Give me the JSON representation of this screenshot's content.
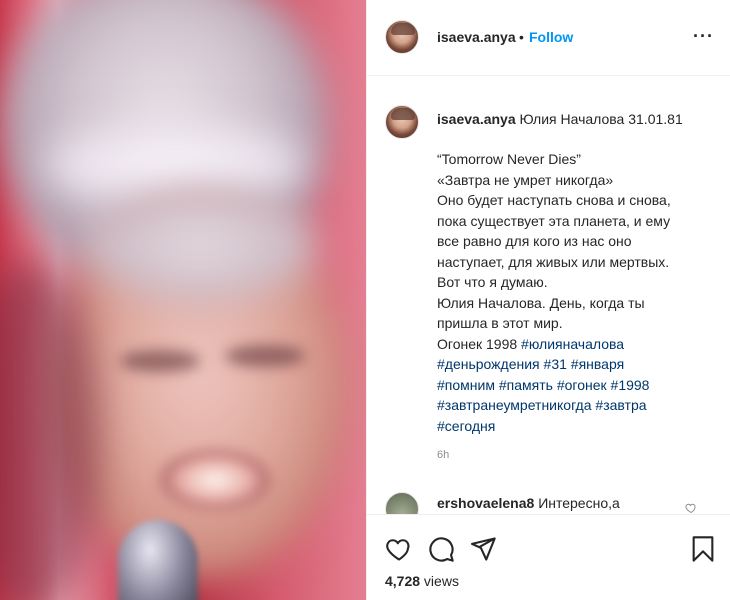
{
  "post": {
    "author": "isaeva.anya",
    "separator": "•",
    "follow_label": "Follow",
    "more_label": "···"
  },
  "caption": {
    "author": "isaeva.anya",
    "header_text": "Юлия Началова 31.01.81",
    "lines": [
      "“Tomorrow Never Dies”",
      "«Завтра не умрет никогда»",
      "Оно будет наступать снова и снова,",
      "пока существует эта планета, и ему",
      "все равно для кого из нас оно",
      "наступает, для живых или мертвых.",
      "Вот что я думаю.",
      "Юлия Началова. День, когда ты",
      "пришла в этот мир."
    ],
    "last_line_prefix": "Огонек 1998 ",
    "hashtags": [
      "#юлияначалова",
      "#деньрождения",
      "#31",
      "#января",
      "#помним",
      "#память",
      "#огонек",
      "#1998",
      "#завтранеумретникогда",
      "#завтра",
      "#сегодня"
    ],
    "time_ago": "6h"
  },
  "comment": {
    "author": "ershovaelena8",
    "text": "Интересно,а"
  },
  "actions": {
    "views_count": "4,728",
    "views_label": " views"
  },
  "icons": {
    "like": "heart-icon",
    "comment": "comment-bubble-icon",
    "share": "paper-plane-icon",
    "save": "bookmark-icon",
    "comment_like": "small-heart-icon",
    "more": "more-options-icon"
  },
  "colors": {
    "accent": "#0095f6",
    "hashtag": "#00376b",
    "text": "#262626",
    "muted": "#8e8e8e",
    "border": "#efefef"
  }
}
